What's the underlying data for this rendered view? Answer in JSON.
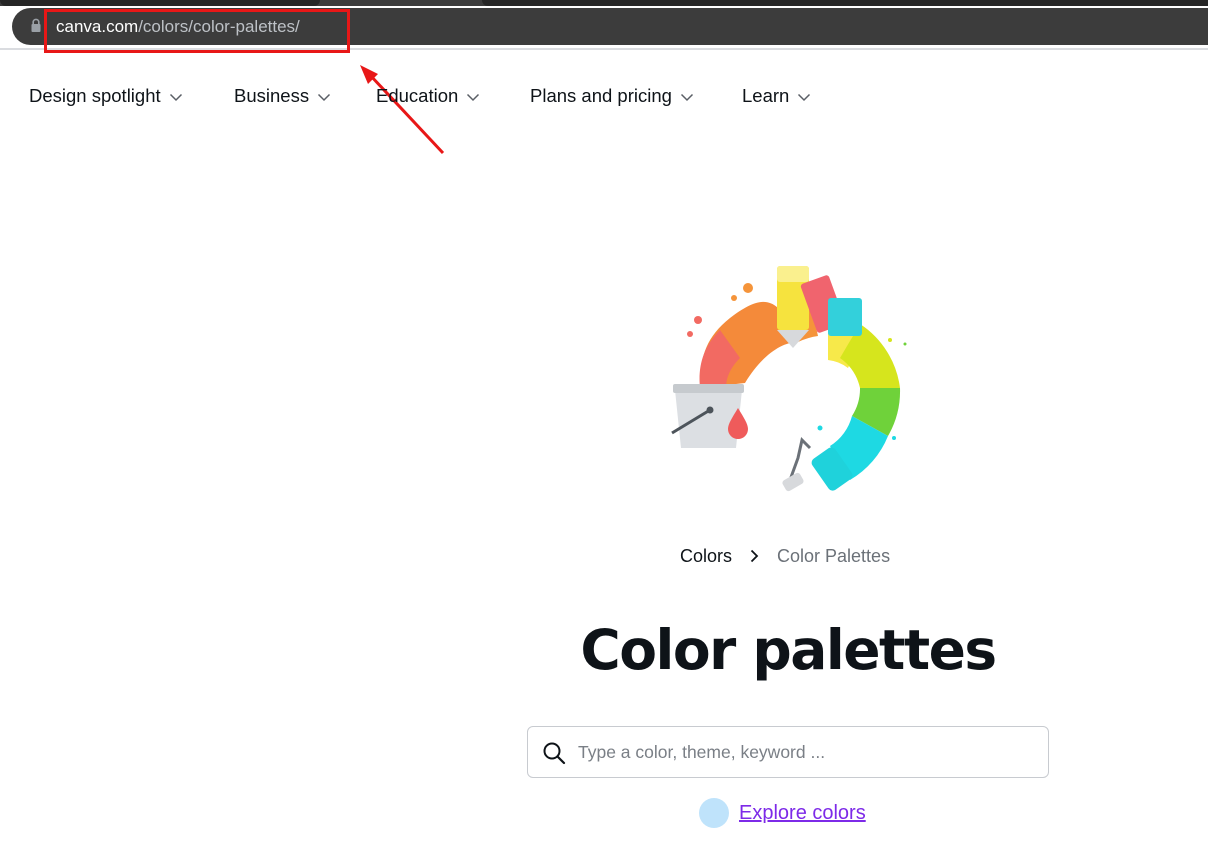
{
  "browser": {
    "url_host": "canva.com",
    "url_path": "/colors/color-palettes/",
    "chrome_color": "#3c3c3c"
  },
  "annotation": {
    "highlight_color": "#e81717"
  },
  "nav": {
    "items": [
      {
        "label": "Design spotlight",
        "icon": "chevron-down-icon"
      },
      {
        "label": "Business",
        "icon": "chevron-down-icon"
      },
      {
        "label": "Education",
        "icon": "chevron-down-icon"
      },
      {
        "label": "Plans and pricing",
        "icon": "chevron-down-icon"
      },
      {
        "label": "Learn",
        "icon": "chevron-down-icon"
      }
    ]
  },
  "breadcrumb": {
    "parent": "Colors",
    "separator_icon": "chevron-right-icon",
    "current": "Color Palettes"
  },
  "main": {
    "title": "Color palettes"
  },
  "search": {
    "icon": "search-icon",
    "placeholder": "Type a color, theme, keyword ...",
    "value": ""
  },
  "explore": {
    "label": "Explore colors",
    "dot_color": "#bfe3fb",
    "link_color": "#7d2ae8"
  }
}
